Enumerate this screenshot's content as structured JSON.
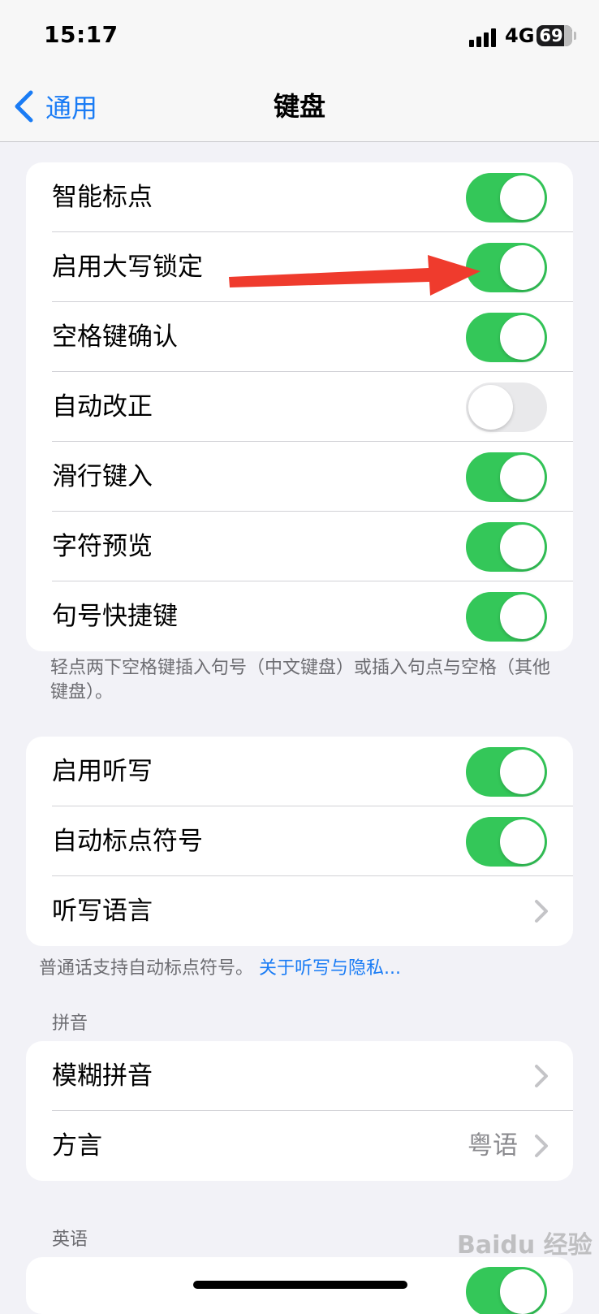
{
  "status": {
    "time": "15:17",
    "network": "4G",
    "battery": "69",
    "battery_level": 0.69
  },
  "nav": {
    "back_label": "通用",
    "title": "键盘"
  },
  "group1": {
    "rows": [
      {
        "label": "智能标点",
        "on": true
      },
      {
        "label": "启用大写锁定",
        "on": true
      },
      {
        "label": "空格键确认",
        "on": true
      },
      {
        "label": "自动改正",
        "on": false
      },
      {
        "label": "滑行键入",
        "on": true
      },
      {
        "label": "字符预览",
        "on": true
      },
      {
        "label": "句号快捷键",
        "on": true
      }
    ],
    "footer": "轻点两下空格键插入句号（中文键盘）或插入句点与空格（其他键盘）。"
  },
  "group2": {
    "rows": [
      {
        "label": "启用听写",
        "on": true
      },
      {
        "label": "自动标点符号",
        "on": true
      },
      {
        "label": "听写语言"
      }
    ],
    "footer_text": "普通话支持自动标点符号。",
    "footer_link": "关于听写与隐私..."
  },
  "pinyin": {
    "header": "拼音",
    "rows": [
      {
        "label": "模糊拼音"
      },
      {
        "label": "方言",
        "value": "粤语"
      }
    ]
  },
  "english": {
    "header": "英语"
  },
  "watermark": "Baidu 经验",
  "colors": {
    "accent": "#1a7cf5",
    "toggle_on": "#34c759",
    "toggle_off": "#e9e9eb",
    "annotation_arrow": "#ef3b2d"
  }
}
